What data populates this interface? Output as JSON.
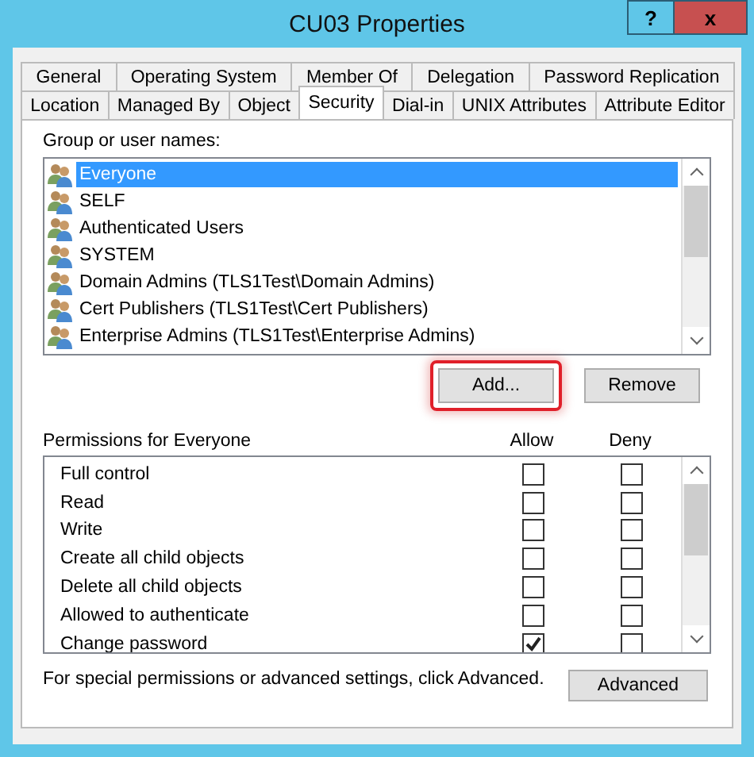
{
  "window": {
    "title": "CU03 Properties",
    "help_button": "?",
    "close_button": "x"
  },
  "tab_rows": [
    [
      {
        "label": "General",
        "selected": false
      },
      {
        "label": "Operating System",
        "selected": false
      },
      {
        "label": "Member Of",
        "selected": false
      },
      {
        "label": "Delegation",
        "selected": false
      },
      {
        "label": "Password Replication",
        "selected": false
      }
    ],
    [
      {
        "label": "Location",
        "selected": false
      },
      {
        "label": "Managed By",
        "selected": false
      },
      {
        "label": "Object",
        "selected": false
      },
      {
        "label": "Security",
        "selected": true
      },
      {
        "label": "Dial-in",
        "selected": false
      },
      {
        "label": "UNIX Attributes",
        "selected": false
      },
      {
        "label": "Attribute Editor",
        "selected": false
      }
    ]
  ],
  "groups": {
    "label": "Group or user names:",
    "items": [
      {
        "name": "Everyone",
        "selected": true
      },
      {
        "name": "SELF",
        "selected": false
      },
      {
        "name": "Authenticated Users",
        "selected": false
      },
      {
        "name": "SYSTEM",
        "selected": false
      },
      {
        "name": "Domain Admins (TLS1Test\\Domain Admins)",
        "selected": false
      },
      {
        "name": "Cert Publishers (TLS1Test\\Cert Publishers)",
        "selected": false
      },
      {
        "name": "Enterprise Admins (TLS1Test\\Enterprise Admins)",
        "selected": false
      }
    ]
  },
  "buttons": [
    {
      "label": "Add...",
      "highlighted": true
    },
    {
      "label": "Remove",
      "highlighted": false
    }
  ],
  "permissions": {
    "label": "Permissions for Everyone",
    "allow_header": "Allow",
    "deny_header": "Deny",
    "items": [
      {
        "name": "Full control",
        "allow": false,
        "deny": false
      },
      {
        "name": "Read",
        "allow": false,
        "deny": false
      },
      {
        "name": "Write",
        "allow": false,
        "deny": false
      },
      {
        "name": "Create all child objects",
        "allow": false,
        "deny": false
      },
      {
        "name": "Delete all child objects",
        "allow": false,
        "deny": false
      },
      {
        "name": "Allowed to authenticate",
        "allow": false,
        "deny": false
      },
      {
        "name": "Change password",
        "allow": true,
        "deny": false
      }
    ]
  },
  "footer": {
    "text": "For special permissions or advanced settings, click Advanced.",
    "button": "Advanced"
  }
}
